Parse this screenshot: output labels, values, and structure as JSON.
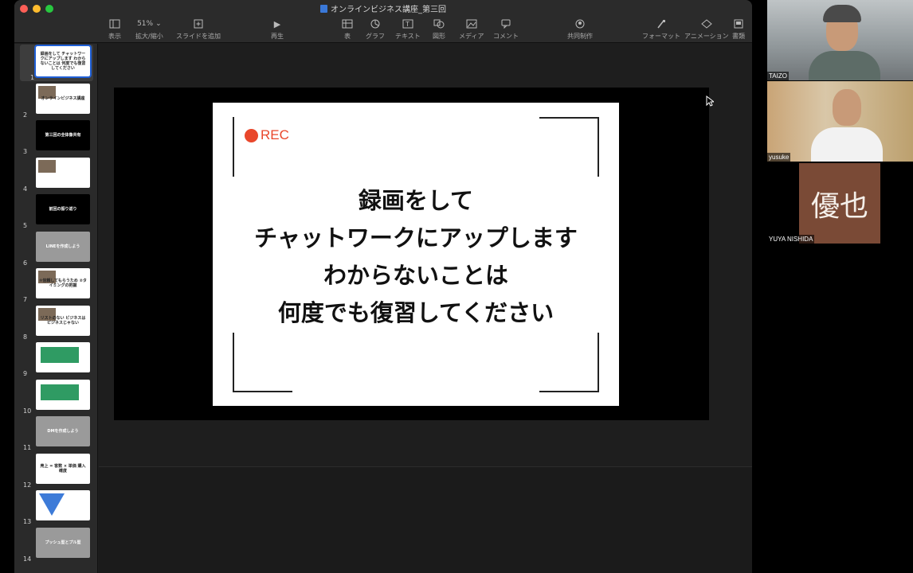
{
  "window": {
    "title": "オンラインビジネス講座_第三回"
  },
  "toolbar": {
    "view_label": "表示",
    "zoom_value": "51%",
    "zoom_label": "拡大/縮小",
    "add_slide_label": "スライドを追加",
    "play_label": "再生",
    "table_label": "表",
    "chart_label": "グラフ",
    "text_label": "テキスト",
    "shape_label": "図形",
    "media_label": "メディア",
    "comment_label": "コメント",
    "collaborate_label": "共同制作",
    "format_label": "フォーマット",
    "animate_label": "アニメーション",
    "document_label": "書類"
  },
  "navigator": {
    "slides": [
      {
        "num": "1",
        "style": "white",
        "text": "録画をして チャットワークにアップします わからないことは 何度でも復習してください"
      },
      {
        "num": "2",
        "style": "white",
        "text": "オンラインビジネス講座"
      },
      {
        "num": "3",
        "style": "black",
        "text": "第三回の全体像共有"
      },
      {
        "num": "4",
        "style": "white",
        "text": ""
      },
      {
        "num": "5",
        "style": "black",
        "text": "前回の振り返り"
      },
      {
        "num": "6",
        "style": "gray",
        "text": "LINEを作成しよう"
      },
      {
        "num": "7",
        "style": "white",
        "text": "①信頼してもらうため ②タイミングの把握"
      },
      {
        "num": "8",
        "style": "white",
        "text": "リストのない ビジネスは ビジネスじゃない"
      },
      {
        "num": "9",
        "style": "white",
        "text": ""
      },
      {
        "num": "10",
        "style": "white",
        "text": ""
      },
      {
        "num": "11",
        "style": "gray",
        "text": "DMを作成しよう"
      },
      {
        "num": "12",
        "style": "white",
        "text": "売上 = 客数 × 単価 購入確度"
      },
      {
        "num": "13",
        "style": "white",
        "text": ""
      },
      {
        "num": "14",
        "style": "gray",
        "text": "プッシュ型とプル型"
      }
    ]
  },
  "slide": {
    "rec_label": "REC",
    "lines": [
      "録画をして",
      "チャットワークにアップします",
      "わからないことは",
      "何度でも復習してください"
    ]
  },
  "participants": [
    {
      "name": "TAIZO"
    },
    {
      "name": "yusuke"
    },
    {
      "name": "YUYA NISHIDA",
      "avatar_text": "優也"
    }
  ],
  "colors": {
    "rec_red": "#e9472b",
    "selection_blue": "#1f5fd6",
    "avatar_bg": "#7a4a36"
  }
}
